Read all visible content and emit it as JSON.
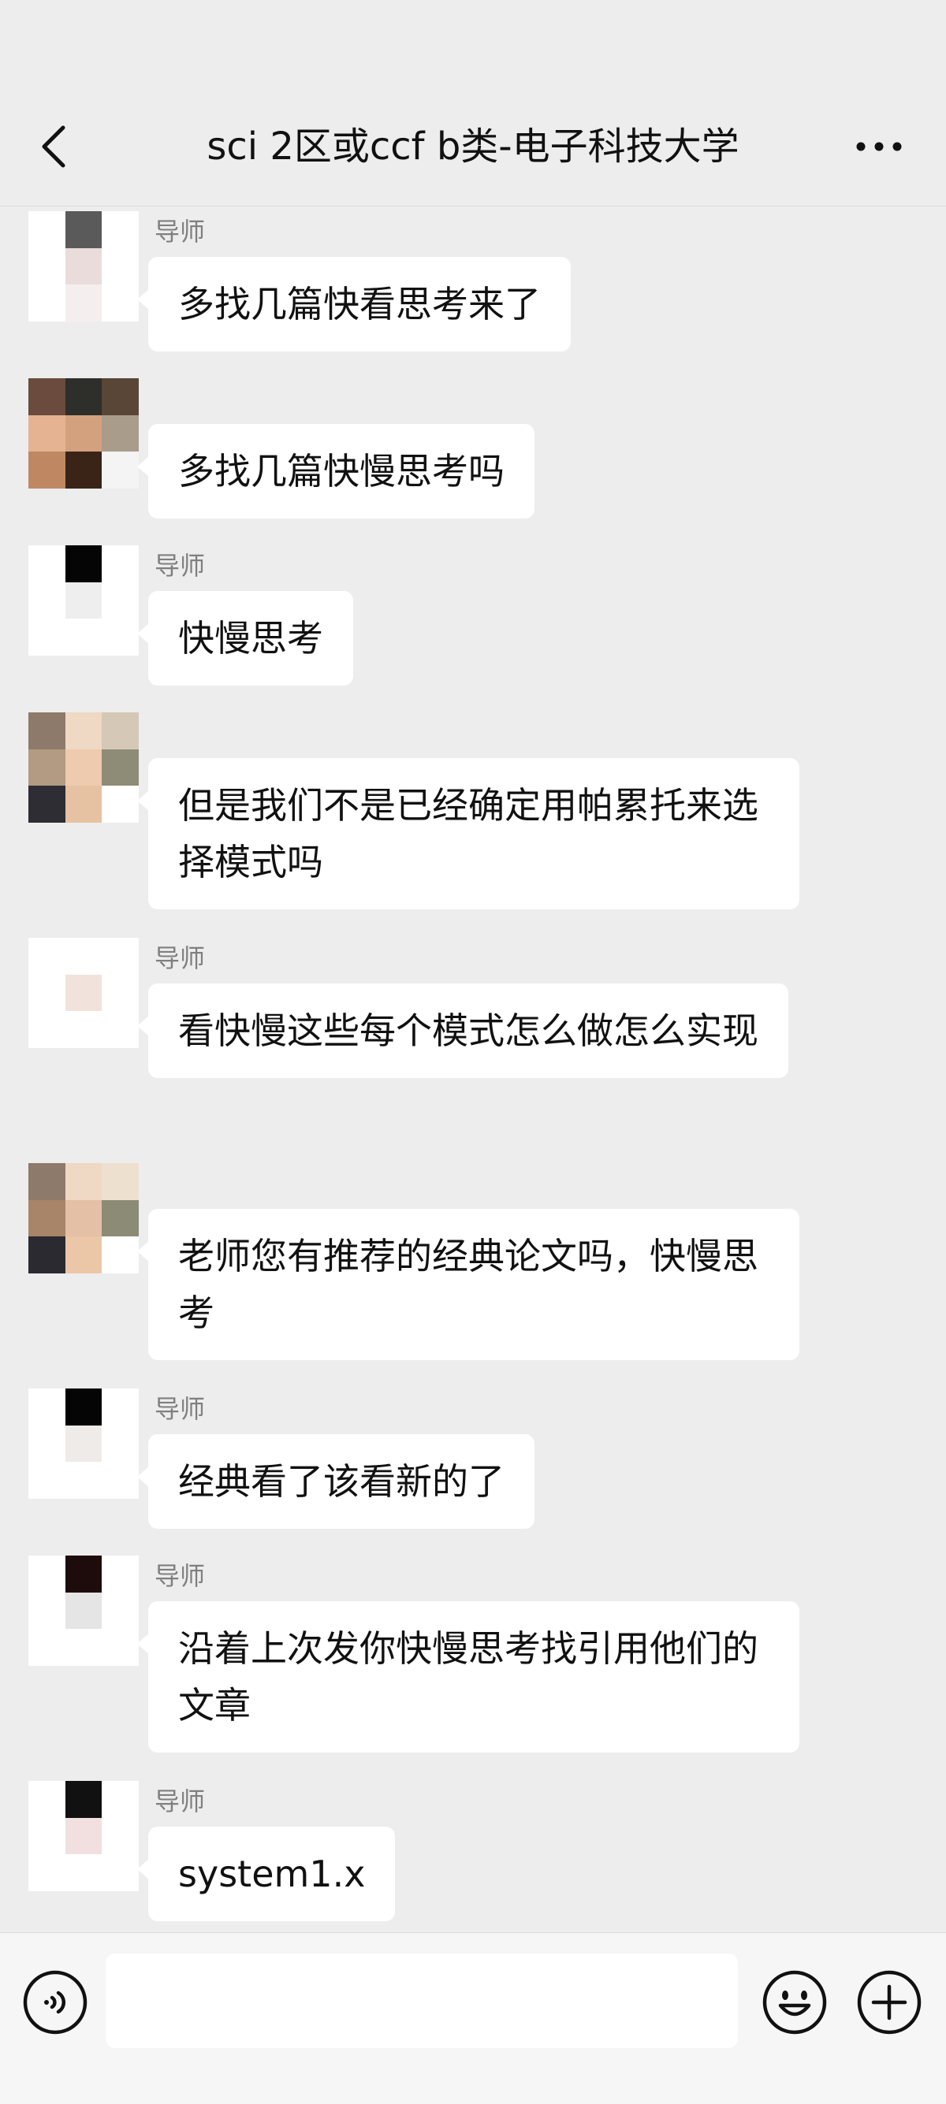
{
  "header": {
    "title": "sci 2区或ccf b类-电子科技大学"
  },
  "messages": [
    {
      "sender": "导师",
      "text": "多找几篇快看思考来了",
      "avatar_colors": [
        "#ffffff",
        "#5a5a5a",
        "#ffffff",
        "#ffffff",
        "#ebdcdc",
        "#ffffff",
        "#ffffff",
        "#f4eeee",
        "#ffffff"
      ]
    },
    {
      "sender": "",
      "text": "多找几篇快慢思考吗",
      "avatar_colors": [
        "#6a4b3d",
        "#2e2e2b",
        "#5a4636",
        "#e5b391",
        "#d4a17f",
        "#a99c8b",
        "#c08862",
        "#3a2418",
        "#f4f4f4"
      ]
    },
    {
      "sender": "导师",
      "text": "快慢思考",
      "avatar_colors": [
        "#ffffff",
        "#050505",
        "#ffffff",
        "#ffffff",
        "#eeeeee",
        "#ffffff",
        "#ffffff",
        "#ffffff",
        "#ffffff"
      ]
    },
    {
      "sender": "",
      "text": "但是我们不是已经确定用帕累托来选择模式吗",
      "avatar_colors": [
        "#8e7a6a",
        "#efd8c4",
        "#d6c8b6",
        "#b29a83",
        "#eecbae",
        "#8e8c77",
        "#2d2d33",
        "#e6c2a2",
        "#ffffff"
      ]
    },
    {
      "sender": "导师",
      "text": "看快慢这些每个模式怎么做怎么实现",
      "avatar_colors": [
        "#ffffff",
        "#ffffff",
        "#ffffff",
        "#ffffff",
        "#f2e2dc",
        "#ffffff",
        "#ffffff",
        "#ffffff",
        "#ffffff"
      ]
    },
    {
      "sender": "",
      "text": "老师您有推荐的经典论文吗，快慢思考",
      "avatar_colors": [
        "#8e7a6a",
        "#efd8c4",
        "#ede0cf",
        "#a88468",
        "#e3c0a6",
        "#8c8b76",
        "#2a2a30",
        "#ebc7a8",
        "#ffffff"
      ]
    },
    {
      "sender": "导师",
      "text": "经典看了该看新的了",
      "avatar_colors": [
        "#ffffff",
        "#050505",
        "#ffffff",
        "#ffffff",
        "#efebe9",
        "#ffffff",
        "#ffffff",
        "#ffffff",
        "#ffffff"
      ]
    },
    {
      "sender": "导师",
      "text": "沿着上次发你快慢思考找引用他们的文章",
      "avatar_colors": [
        "#ffffff",
        "#1e0c0c",
        "#ffffff",
        "#ffffff",
        "#e5e5e5",
        "#ffffff",
        "#ffffff",
        "#ffffff",
        "#ffffff"
      ]
    },
    {
      "sender": "导师",
      "text": "system1.x",
      "avatar_colors": [
        "#ffffff",
        "#111111",
        "#ffffff",
        "#ffffff",
        "#f2e0e0",
        "#ffffff",
        "#ffffff",
        "#ffffff",
        "#ffffff"
      ]
    }
  ],
  "input": {
    "value": "",
    "placeholder": ""
  },
  "colors": {
    "background": "#ededed",
    "bubble": "#ffffff",
    "sender_name": "#7f7f7f"
  },
  "icons": {
    "back": "chevron-left-icon",
    "more": "more-dots-icon",
    "voice": "voice-icon",
    "emoji": "emoji-icon",
    "plus": "plus-icon"
  }
}
